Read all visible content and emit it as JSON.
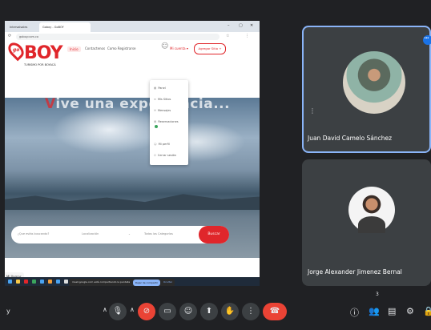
{
  "browser": {
    "tab1_title": "Intervalsales",
    "tab2_title": "Goboy - GoBOY",
    "url": "goboy.com.co"
  },
  "site": {
    "logo_go": "go",
    "logo_boy": "BOY",
    "tagline": "TURISMO POR BOYACÁ",
    "nav": [
      "Inicio",
      "Contactenos",
      "Como Registrarse"
    ],
    "account_label": "Mi cuenta ▾",
    "add_site_label": "Agregar Sitio +",
    "dropdown": [
      "Panel",
      "Mis Sitios",
      "Mensajes",
      "Reservaciones",
      "Mi perfil",
      "Cerrar sesión"
    ],
    "hero_first": "V",
    "hero_rest": "ive una experiencia...",
    "search_placeholder": "¿Que estás buscando?",
    "location_placeholder": "Localización",
    "categories_placeholder": "Todas las Categorías",
    "search_button": "Buscar",
    "left_chip": "Mi llamar"
  },
  "screen_share": {
    "notice": "meet.google.com está compartiendo la pantalla",
    "stop_label": "Dejar de compartir",
    "hide_label": "Ocultar"
  },
  "participants": [
    {
      "name": "Juan David Camelo Sánchez"
    },
    {
      "name": "Jorge Alexander Jimenez Bernal"
    }
  ],
  "people_count": "3",
  "left_char": "y",
  "icons": {
    "mic": "microphone-icon",
    "cam": "camera-off-icon",
    "cc": "captions-icon",
    "emoji": "emoji-icon",
    "present": "present-icon",
    "hand": "raise-hand-icon",
    "more": "more-vert-icon",
    "leave": "phone-hangup-icon",
    "info": "info-icon",
    "people": "people-icon",
    "chat": "chat-icon",
    "activities": "activities-icon",
    "lock": "lock-icon"
  },
  "colors": {
    "brand_red": "#e0262b",
    "meet_bg": "#202124",
    "tile_bg": "#3c4043",
    "active_border": "#8ab4f8",
    "leave_red": "#ea4335"
  }
}
